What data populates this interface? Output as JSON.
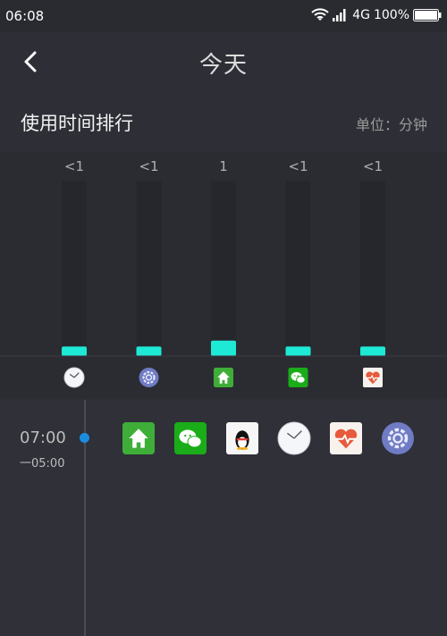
{
  "status_bar": {
    "time": "06:08",
    "network": "4G",
    "battery": "100%"
  },
  "header": {
    "title": "今天"
  },
  "section": {
    "title": "使用时间排行",
    "unit": "单位：分钟"
  },
  "chart_data": {
    "type": "bar",
    "categories": [
      "clock",
      "settings",
      "launcher",
      "wechat",
      "health"
    ],
    "labels": [
      "<1",
      "<1",
      "1",
      "<1",
      "<1"
    ],
    "values": [
      0.5,
      0.5,
      1,
      0.5,
      0.5
    ],
    "colors": {
      "bar": "#1ee9d5",
      "track": "#26272d"
    }
  },
  "timeline": {
    "start": "07:00",
    "end": "一05:00",
    "apps": [
      "launcher-icon",
      "wechat-icon",
      "qq-icon",
      "clock-icon",
      "health-icon",
      "settings-icon"
    ]
  }
}
